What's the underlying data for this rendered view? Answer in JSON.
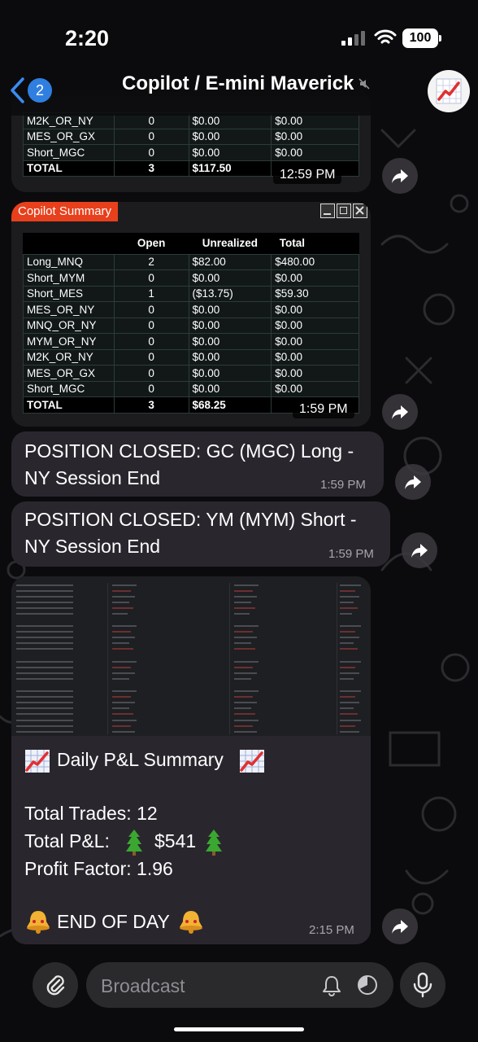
{
  "status_bar": {
    "time": "2:20",
    "battery": "100"
  },
  "header": {
    "back_count": "2",
    "title": "Copilot / E-mini Maverick"
  },
  "summary_top": {
    "rows": [
      {
        "name": "M2K_OR_NY",
        "open": "0",
        "unrealized": "$0.00",
        "total": "$0.00"
      },
      {
        "name": "MES_OR_GX",
        "open": "0",
        "unrealized": "$0.00",
        "total": "$0.00"
      },
      {
        "name": "Short_MGC",
        "open": "0",
        "unrealized": "$0.00",
        "total": "$0.00"
      }
    ],
    "total": {
      "label": "TOTAL",
      "open": "3",
      "unrealized": "$117.50",
      "total": "$..."
    },
    "time": "12:59 PM"
  },
  "summary_main": {
    "panel_title": "Copilot Summary",
    "headers": {
      "open": "Open",
      "unrealized": "Unrealized",
      "total": "Total"
    },
    "rows": [
      {
        "name": "Long_MNQ",
        "open": "2",
        "unrealized": "$82.00",
        "total": "$480.00",
        "u_color": "green",
        "t_color": "green"
      },
      {
        "name": "Short_MYM",
        "open": "0",
        "unrealized": "$0.00",
        "total": "$0.00",
        "u_color": "white",
        "t_color": "white"
      },
      {
        "name": "Short_MES",
        "open": "1",
        "unrealized": "($13.75)",
        "total": "$59.30",
        "u_color": "red",
        "t_color": "green"
      },
      {
        "name": "MES_OR_NY",
        "open": "0",
        "unrealized": "$0.00",
        "total": "$0.00",
        "u_color": "white",
        "t_color": "white"
      },
      {
        "name": "MNQ_OR_NY",
        "open": "0",
        "unrealized": "$0.00",
        "total": "$0.00",
        "u_color": "white",
        "t_color": "white"
      },
      {
        "name": "MYM_OR_NY",
        "open": "0",
        "unrealized": "$0.00",
        "total": "$0.00",
        "u_color": "white",
        "t_color": "white"
      },
      {
        "name": "M2K_OR_NY",
        "open": "0",
        "unrealized": "$0.00",
        "total": "$0.00",
        "u_color": "white",
        "t_color": "white"
      },
      {
        "name": "MES_OR_GX",
        "open": "0",
        "unrealized": "$0.00",
        "total": "$0.00",
        "u_color": "white",
        "t_color": "white"
      },
      {
        "name": "Short_MGC",
        "open": "0",
        "unrealized": "$0.00",
        "total": "$0.00",
        "u_color": "white",
        "t_color": "white"
      }
    ],
    "total": {
      "label": "TOTAL",
      "open": "3",
      "unrealized": "$68.25"
    },
    "time": "1:59 PM"
  },
  "msg_gc": {
    "line1": "POSITION CLOSED: GC (MGC) Long -",
    "line2": "NY Session End",
    "time": "1:59 PM"
  },
  "msg_ym": {
    "line1": "POSITION CLOSED: YM (MYM) Short -",
    "line2": "NY Session End",
    "time": "1:59 PM"
  },
  "daily": {
    "heading": "Daily P&L Summary",
    "trades": "Total Trades: 12",
    "pnl_label": "Total P&L:",
    "pnl_value": "$541",
    "profit_factor": "Profit Factor: 1.96",
    "end": "END OF DAY",
    "time": "2:15 PM"
  },
  "input": {
    "placeholder": "Broadcast"
  },
  "colors": {
    "accent": "#2f7fe0",
    "panel_title": "#e8401c",
    "positive": "#26e03a",
    "negative": "#ff3030",
    "bubble": "#2a262e"
  }
}
